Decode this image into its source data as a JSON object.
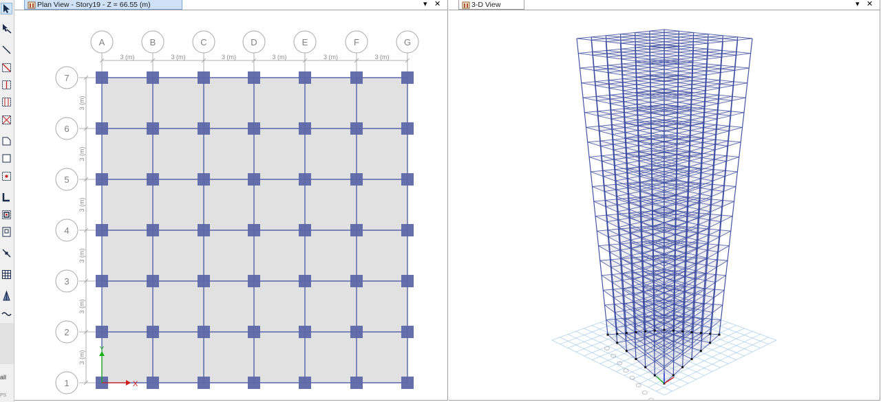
{
  "toolbar": {
    "tools": [
      {
        "name": "select-pointer-icon",
        "active": true
      },
      {
        "name": "reshape-pointer-icon",
        "active": false
      },
      {
        "name": "draw-beam-icon",
        "active": false
      },
      {
        "name": "draw-brace-icon",
        "active": false
      },
      {
        "name": "draw-column-icon",
        "active": false
      },
      {
        "name": "quick-draw-column-icon",
        "active": false
      },
      {
        "name": "draw-x-brace-icon",
        "active": false
      },
      {
        "name": "draw-polygon-area-icon",
        "active": false
      },
      {
        "name": "draw-rectangle-area-icon",
        "active": false
      },
      {
        "name": "quick-draw-area-icon",
        "active": false
      },
      {
        "name": "draw-wall-icon",
        "active": false
      },
      {
        "name": "quick-draw-wall-icon",
        "active": false
      },
      {
        "name": "draw-wall-opening-icon",
        "active": false
      },
      {
        "name": "draw-link-icon",
        "active": false
      },
      {
        "name": "draw-grid-icon",
        "active": false
      },
      {
        "name": "draw-tendon-icon",
        "active": false
      },
      {
        "name": "draw-wave-icon",
        "active": false
      }
    ],
    "all_label": "all",
    "ps_label": "PS"
  },
  "plan_view": {
    "tab_title": "Plan View - Story19 - Z = 66.55 (m)",
    "x_grid_labels": [
      "A",
      "B",
      "C",
      "D",
      "E",
      "F",
      "G"
    ],
    "y_grid_labels": [
      "1",
      "2",
      "3",
      "4",
      "5",
      "6",
      "7"
    ],
    "x_spacings": [
      "3 (m)",
      "3 (m)",
      "3 (m)",
      "3 (m)",
      "3 (m)",
      "3 (m)"
    ],
    "y_spacings": [
      "3 (m)",
      "3 (m)",
      "3 (m)",
      "3 (m)",
      "3 (m)",
      "3 (m)"
    ],
    "axis_x_label": "X",
    "axis_y_label": "Y",
    "slab_color": "#e1e1e1",
    "frame_color": "#3a4aa0",
    "column_color": "#5c67a8"
  },
  "view_3d": {
    "tab_title": "3-D View",
    "frame_color": "#3a4aa0",
    "slab_color": "#c8cad8",
    "ground_grid_color": "#9cc8ec"
  },
  "window_controls": {
    "dropdown_glyph": "▾",
    "close_glyph": "✕"
  }
}
